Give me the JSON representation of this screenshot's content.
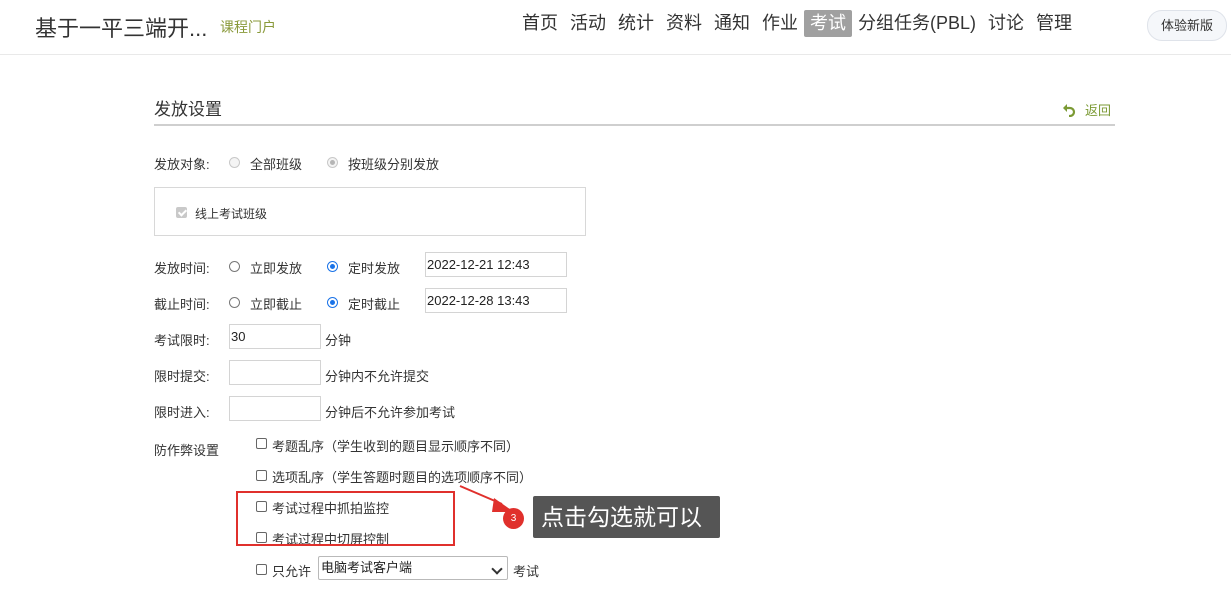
{
  "header": {
    "course_title": "基于一平三端开...",
    "portal_link": "课程门户",
    "nav": [
      {
        "label": "首页"
      },
      {
        "label": "活动"
      },
      {
        "label": "统计"
      },
      {
        "label": "资料"
      },
      {
        "label": "通知"
      },
      {
        "label": "作业"
      },
      {
        "label": "考试",
        "active": true
      },
      {
        "label": "分组任务(PBL)"
      },
      {
        "label": "讨论"
      },
      {
        "label": "管理"
      }
    ],
    "new_version_button": "体验新版"
  },
  "page": {
    "title": "发放设置",
    "back_label": "返回"
  },
  "target": {
    "label": "发放对象:",
    "options": [
      "全部班级",
      "按班级分别发放"
    ],
    "selected": "按班级分别发放",
    "class_checkbox_label": "线上考试班级"
  },
  "release_time": {
    "label": "发放时间:",
    "options": [
      "立即发放",
      "定时发放"
    ],
    "selected": "定时发放",
    "value": "2022-12-21 12:43"
  },
  "deadline": {
    "label": "截止时间:",
    "options": [
      "立即截止",
      "定时截止"
    ],
    "selected": "定时截止",
    "value": "2022-12-28 13:43"
  },
  "time_limit": {
    "label": "考试限时:",
    "value": "30",
    "unit": "分钟"
  },
  "submit_limit": {
    "label": "限时提交:",
    "value": "",
    "suffix": "分钟内不允许提交"
  },
  "entry_limit": {
    "label": "限时进入:",
    "value": "",
    "suffix": "分钟后不允许参加考试"
  },
  "anti_cheat": {
    "label": "防作弊设置",
    "options": [
      {
        "label": "考题乱序（学生收到的题目显示顺序不同）",
        "checked": false
      },
      {
        "label": "选项乱序（学生答题时题目的选项顺序不同）",
        "checked": false
      },
      {
        "label": "考试过程中抓拍监控",
        "checked": false
      },
      {
        "label": "考试过程中切屏控制",
        "checked": false
      }
    ],
    "allow_only_label": "只允许",
    "client_select": "电脑考试客户端",
    "allow_only_suffix": "考试"
  },
  "annotation": {
    "step": "3",
    "text": "点击勾选就可以",
    "color": "#e0302c"
  }
}
